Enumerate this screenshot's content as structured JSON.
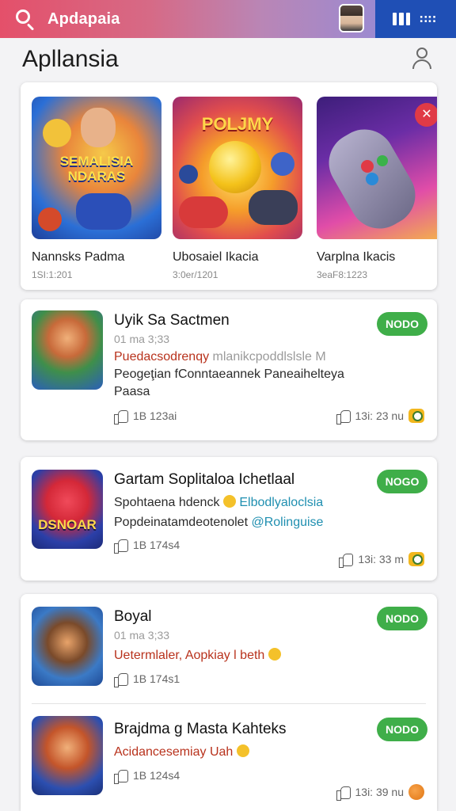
{
  "topbar": {
    "search_text": "Apdapaia",
    "brand_color": "#e4506a",
    "right_dots": "∷∷"
  },
  "header": {
    "title": "Apllansia"
  },
  "featured": [
    {
      "name": "Nannsks Padma",
      "meta": "1SI:1:201",
      "overlay": "SEMALISIA NDARAS"
    },
    {
      "name": "Ubosaiel Ikacia",
      "meta": "3:0er/1201",
      "overlay": "POLJMY"
    },
    {
      "name": "Varplna Ikacis",
      "meta": "3eaF8:1223"
    }
  ],
  "list": [
    {
      "title": "Uyik Sa Sactmen",
      "sub": "01 ma 3;33",
      "line1_a": "Puedacsodrenqy",
      "line1_b": "mlanikcpoddlslsle M",
      "line2": "Peogeţian fConntaeannek Paneaihelteya",
      "line3": "Paasa",
      "badge": "NODO",
      "likes": "1B 123ai",
      "stat": "13i: 23 nu"
    },
    {
      "title": "Gartam Soplitaloa Ichetlaal",
      "line1_a": "Spohtaena hdenck",
      "line1_b": "Elbodlyaloclsia",
      "line2_a": "Popdeinatamdeotenolet",
      "line2_b": "@Rolinguise",
      "badge": "NOGO",
      "likes": "1B 174s4",
      "stat": "13i: 33 m",
      "icon_text": "DSNOAR"
    },
    {
      "title": "Boyal",
      "sub": "01 ma 3;33",
      "line1": "Uetermlaler, Aopkiay l beth",
      "badge": "NODO",
      "likes": "1B 174s1"
    },
    {
      "title": "Brajdma g Masta Kahteks",
      "line1": "Acidancesemiay Uah",
      "badge": "NODO",
      "likes": "1B 124s4",
      "stat": "13i: 39 nu"
    }
  ]
}
